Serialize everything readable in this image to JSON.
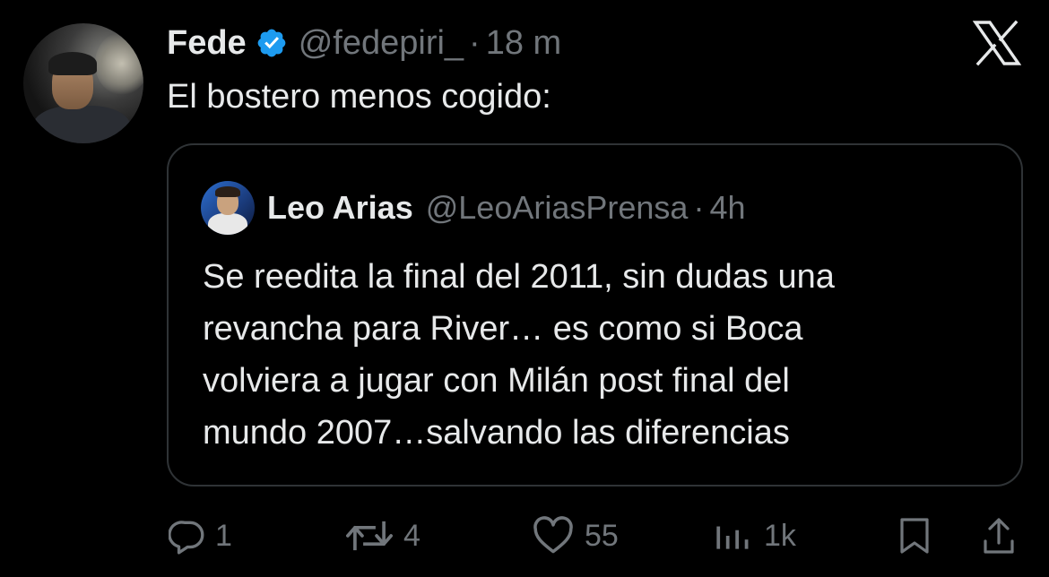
{
  "author": {
    "name": "Fede",
    "handle": "@fedepiri_",
    "separator": "·",
    "time": "18 m",
    "verified_color": "#1d9bf0"
  },
  "tweet": {
    "text": "El bostero menos cogido:"
  },
  "quoted": {
    "name": "Leo Arias",
    "handle": "@LeoAriasPrensa",
    "separator": "·",
    "time": "4h",
    "lines": [
      "Se reedita la final del 2011, sin dudas una",
      "revancha para River… es como si Boca",
      "volviera a jugar con Milán post final del",
      "mundo 2007…salvando las diferencias"
    ]
  },
  "actions": {
    "replies": "1",
    "retweets": "4",
    "likes": "55",
    "views": "1k"
  },
  "icons": [
    "x-logo-icon",
    "verified-badge-icon",
    "reply-icon",
    "retweet-icon",
    "like-icon",
    "views-icon",
    "bookmark-icon",
    "share-icon"
  ],
  "colors": {
    "background": "#000000",
    "text": "#e7e9ea",
    "muted": "#71767b",
    "border": "#2f3336"
  }
}
